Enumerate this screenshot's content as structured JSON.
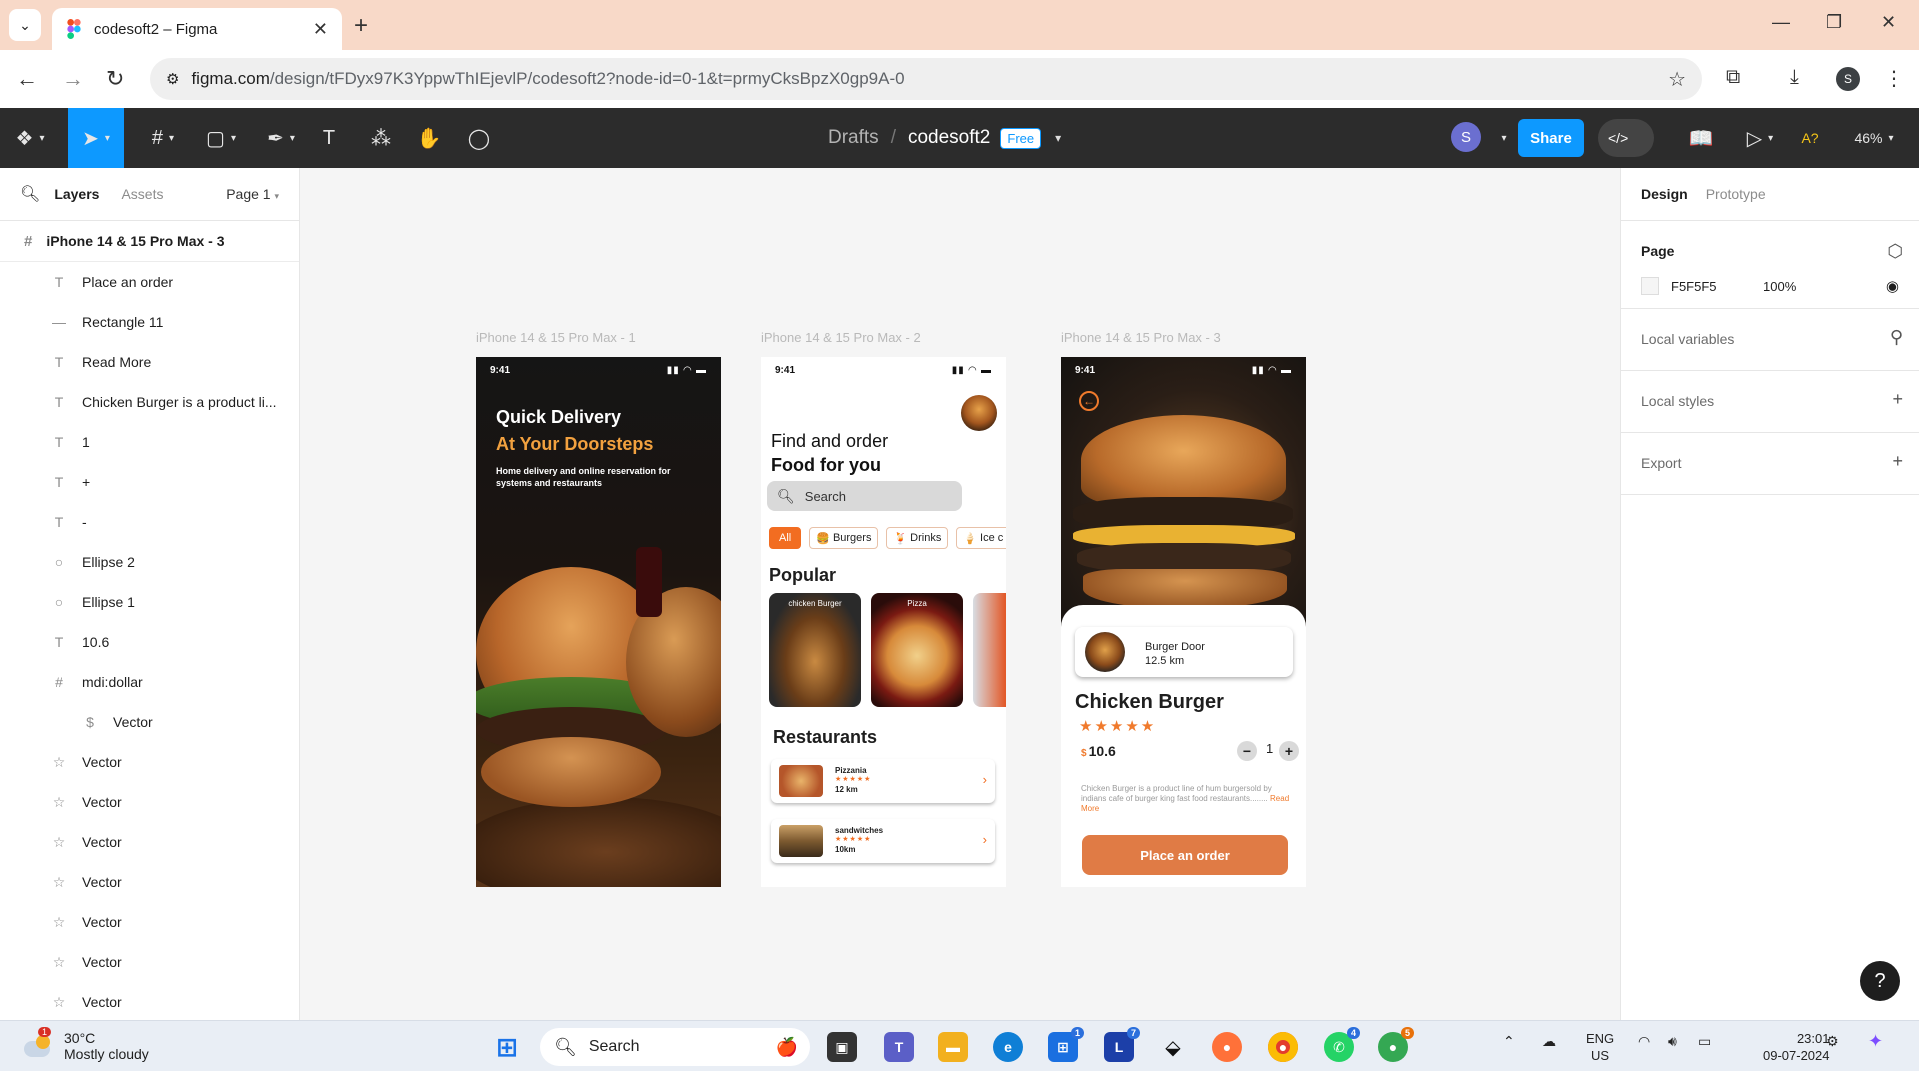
{
  "browser": {
    "tab_title": "codesoft2 – Figma",
    "url_host": "figma.com",
    "url_path": "/design/tFDyx97K3YppwThIEjevlP/codesoft2?node-id=0-1&t=prmyCksBpzX0gp9A-0",
    "profile_initial": "S"
  },
  "toolbar": {
    "breadcrumb_drafts": "Drafts",
    "breadcrumb_sep": "/",
    "file_name": "codesoft2",
    "plan_badge": "Free",
    "avatar_initial": "S",
    "share_label": "Share",
    "zoom": "46%",
    "accessibility_label": "A?"
  },
  "left_panel": {
    "tab_layers": "Layers",
    "tab_assets": "Assets",
    "page_selector": "Page 1",
    "frame_name": "iPhone 14 & 15 Pro Max - 3",
    "layers": [
      {
        "icon": "T",
        "label": "Place an order"
      },
      {
        "icon": "—",
        "label": "Rectangle 11"
      },
      {
        "icon": "T",
        "label": "Read More"
      },
      {
        "icon": "T",
        "label": "Chicken Burger is a product li..."
      },
      {
        "icon": "T",
        "label": "1"
      },
      {
        "icon": "T",
        "label": "+"
      },
      {
        "icon": "T",
        "label": "-"
      },
      {
        "icon": "○",
        "label": "Ellipse 2"
      },
      {
        "icon": "○",
        "label": "Ellipse 1"
      },
      {
        "icon": "T",
        "label": "10.6"
      },
      {
        "icon": "#",
        "label": "mdi:dollar"
      },
      {
        "icon": "$",
        "label": "Vector"
      },
      {
        "icon": "☆",
        "label": "Vector"
      },
      {
        "icon": "☆",
        "label": "Vector"
      },
      {
        "icon": "☆",
        "label": "Vector"
      },
      {
        "icon": "☆",
        "label": "Vector"
      },
      {
        "icon": "☆",
        "label": "Vector"
      },
      {
        "icon": "☆",
        "label": "Vector"
      },
      {
        "icon": "☆",
        "label": "Vector"
      }
    ]
  },
  "right_panel": {
    "tab_design": "Design",
    "tab_prototype": "Prototype",
    "page_heading": "Page",
    "page_fill_hex": "F5F5F5",
    "page_fill_opacity": "100%",
    "local_variables": "Local variables",
    "local_styles": "Local styles",
    "export": "Export"
  },
  "canvas": {
    "frame_labels": [
      "iPhone 14 & 15 Pro Max - 1",
      "iPhone 14 & 15 Pro Max - 2",
      "iPhone 14 & 15 Pro Max - 3"
    ],
    "time": "9:41",
    "phone1": {
      "heading1": "Quick Delivery",
      "heading2": "At Your Doorsteps",
      "subtitle": "Home delivery and online reservation for systems and restaurants"
    },
    "phone2": {
      "line1": "Find and order",
      "line2": "Food for you",
      "search_placeholder": "Search",
      "chips": [
        "All",
        "Burgers",
        "Drinks",
        "Ice c"
      ],
      "popular_heading": "Popular",
      "popular_cards": [
        "chicken Burger",
        "Pizza"
      ],
      "restaurants_heading": "Restaurants",
      "restaurants": [
        {
          "name": "Pizzania",
          "stars": "★★★★★",
          "distance": "12 km"
        },
        {
          "name": "sandwitches",
          "stars": "★★★★★",
          "distance": "10km"
        }
      ]
    },
    "phone3": {
      "store_name": "Burger Door",
      "store_distance": "12.5 km",
      "title": "Chicken Burger",
      "stars": "★★★★★",
      "currency": "$",
      "price": "10.6",
      "minus": "−",
      "quantity": "1",
      "plus": "+",
      "description": "Chicken Burger is a product line of hum burgersold by indians cafe of burger king fast food restaurants........",
      "read_more": "Read More",
      "order_button": "Place an order"
    }
  },
  "taskbar": {
    "weather_temp": "30°C",
    "weather_desc": "Mostly cloudy",
    "weather_badge": "1",
    "search_label": "Search",
    "lang_top": "ENG",
    "lang_bottom": "US",
    "time": "23:01",
    "date": "09-07-2024",
    "badges": {
      "store": "1",
      "l_app": "7",
      "whatsapp": "4",
      "chrome2": "5"
    }
  },
  "colors": {
    "figma_blue": "#0d99ff",
    "accent_orange": "#f07a2c",
    "tab_strip": "#f8d9c8",
    "order_button": "#e07b45"
  }
}
